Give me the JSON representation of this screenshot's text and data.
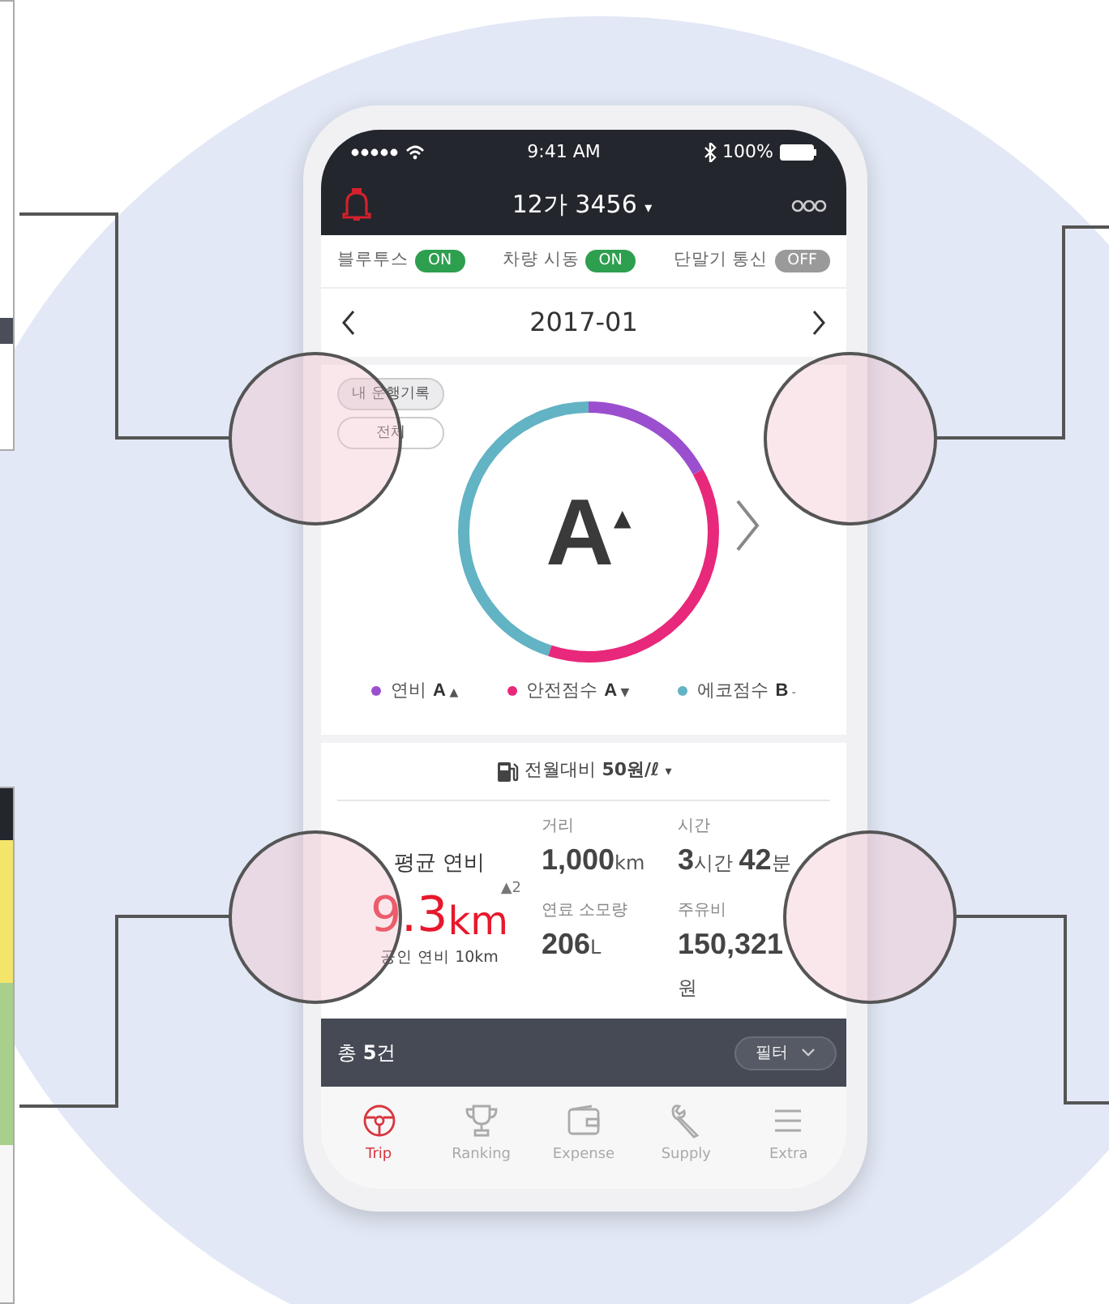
{
  "status_bar": {
    "time": "9:41 AM",
    "battery": "100%"
  },
  "header": {
    "title": "12가 3456",
    "caret": "▾"
  },
  "toggles": [
    {
      "label": "블루투스",
      "state_text": "ON",
      "on": true
    },
    {
      "label": "차량 시동",
      "state_text": "ON",
      "on": true
    },
    {
      "label": "단말기 통신",
      "state_text": "OFF",
      "on": false
    }
  ],
  "month_nav": {
    "month": "2017-01"
  },
  "filters": [
    {
      "label": "내 운행기록",
      "selected": true
    },
    {
      "label": "전체",
      "selected": false
    }
  ],
  "grade": {
    "value": "A",
    "trend": "▲"
  },
  "legend": [
    {
      "label": "연비",
      "grade": "A",
      "trend": "▲",
      "color": "#9b4fcf"
    },
    {
      "label": "안전점수",
      "grade": "A",
      "trend": "▼",
      "color": "#e8287a"
    },
    {
      "label": "에코점수",
      "grade": "B",
      "trend": "-",
      "color": "#62b3c3"
    }
  ],
  "fuel_price": {
    "text": "전월대비 **50원/ℓ**",
    "caret": "▾"
  },
  "average": {
    "label": "평균 연비",
    "value": "9.3",
    "unit": "km",
    "change": "▲2",
    "official": "공인 연비 10km"
  },
  "stats": [
    {
      "label": "거리",
      "parts": [
        {
          "kind": "number",
          "text": "1,000"
        },
        {
          "kind": "unit",
          "text": "km"
        }
      ]
    },
    {
      "label": "시간",
      "parts": [
        {
          "kind": "number",
          "text": "3"
        },
        {
          "kind": "unit",
          "text": "시간 "
        },
        {
          "kind": "number",
          "text": "42"
        },
        {
          "kind": "unit",
          "text": "분"
        }
      ]
    },
    {
      "label": "연료 소모량",
      "parts": [
        {
          "kind": "number",
          "text": "206"
        },
        {
          "kind": "unit",
          "text": "L"
        }
      ]
    },
    {
      "label": "주유비",
      "parts": [
        {
          "kind": "number",
          "text": "150,321"
        },
        {
          "kind": "unit",
          "text": "원"
        }
      ]
    }
  ],
  "list_bar": {
    "count": "총 **5**건",
    "filter_button": "필터"
  },
  "tabs": [
    {
      "label": "Trip",
      "selected": true
    },
    {
      "label": "Ranking",
      "selected": false
    },
    {
      "label": "Expense",
      "selected": false
    },
    {
      "label": "Supply",
      "selected": false
    },
    {
      "label": "Extra",
      "selected": false
    }
  ]
}
